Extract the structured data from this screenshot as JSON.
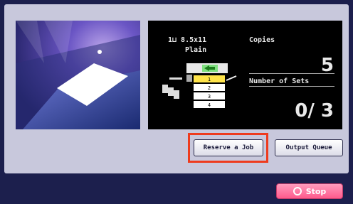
{
  "status": {
    "paper_size": "1⊔ 8.5x11",
    "paper_type": "Plain",
    "copies_label": "Copies",
    "copies_value": "5",
    "sets_label": "Number of Sets",
    "sets_value": "0/ 3",
    "tray_numbers": [
      "1",
      "2",
      "3",
      "4"
    ]
  },
  "buttons": {
    "reserve_label": "Reserve a Job",
    "queue_label": "Output Queue",
    "stop_label": "Stop"
  },
  "colors": {
    "highlight": "#ee3b1e",
    "stop": "#ff6f98",
    "frame": "#1c1f4d"
  }
}
